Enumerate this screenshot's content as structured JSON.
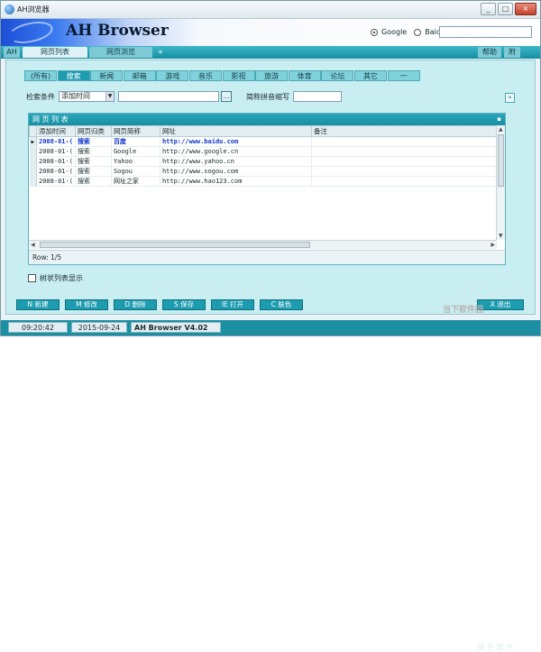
{
  "window": {
    "title": "AH浏览器",
    "controls": [
      "_",
      "□",
      "×"
    ]
  },
  "banner": {
    "logo": "AH Browser"
  },
  "engines": {
    "options": [
      "Google",
      "Baidu"
    ],
    "selected": "Google",
    "search_value": ""
  },
  "menubar": {
    "left_label": "AH",
    "tabs": [
      "网页列表",
      "网页浏览"
    ],
    "active_tab": "网页列表",
    "add_tab": "+",
    "right": [
      "帮助",
      "附"
    ]
  },
  "categories": [
    "(所有)",
    "搜索",
    "新闻",
    "邮箱",
    "游戏",
    "音乐",
    "影视",
    "旅游",
    "体育",
    "论坛",
    "其它",
    "一"
  ],
  "active_category": "搜索",
  "filter": {
    "criteria_label": "检索条件",
    "criteria_value": "添加时间",
    "criteria_input": "",
    "pinyin_label": "简称拼音缩写",
    "pinyin_input": "",
    "dots": "...",
    "expand": "»"
  },
  "grid": {
    "title": "网 页 列 表",
    "columns": [
      "添加时间",
      "网页归类",
      "网页简称",
      "网址",
      "备注"
    ],
    "rows": [
      {
        "time": "2008-01-(",
        "category": "搜索",
        "name": "百度",
        "url": "http://www.baidu.com",
        "note": ""
      },
      {
        "time": "2008-01-(",
        "category": "搜索",
        "name": "Google",
        "url": "http://www.google.cn",
        "note": ""
      },
      {
        "time": "2008-01-(",
        "category": "搜索",
        "name": "Yahoo",
        "url": "http://www.yahoo.cn",
        "note": ""
      },
      {
        "time": "2008-01-(",
        "category": "搜索",
        "name": "Sogou",
        "url": "http://www.sogou.com",
        "note": ""
      },
      {
        "time": "2008-01-(",
        "category": "搜索",
        "name": "网址之家",
        "url": "http://www.hao123.com",
        "note": ""
      }
    ],
    "row_count": "Row: 1/5",
    "selected_row": 0
  },
  "tree_checkbox": "树状列表显示",
  "buttons": [
    "N 新建",
    "M 修改",
    "D 删除",
    "S 保存",
    "IE 打开",
    "C 肤色"
  ],
  "exit_button": "X 退出",
  "status": {
    "time": "09:20:42",
    "date": "2015-09-24",
    "version": "AH Browser V4.02"
  },
  "watermark": "当下软件园",
  "watermark2": "绿 手 软 件"
}
